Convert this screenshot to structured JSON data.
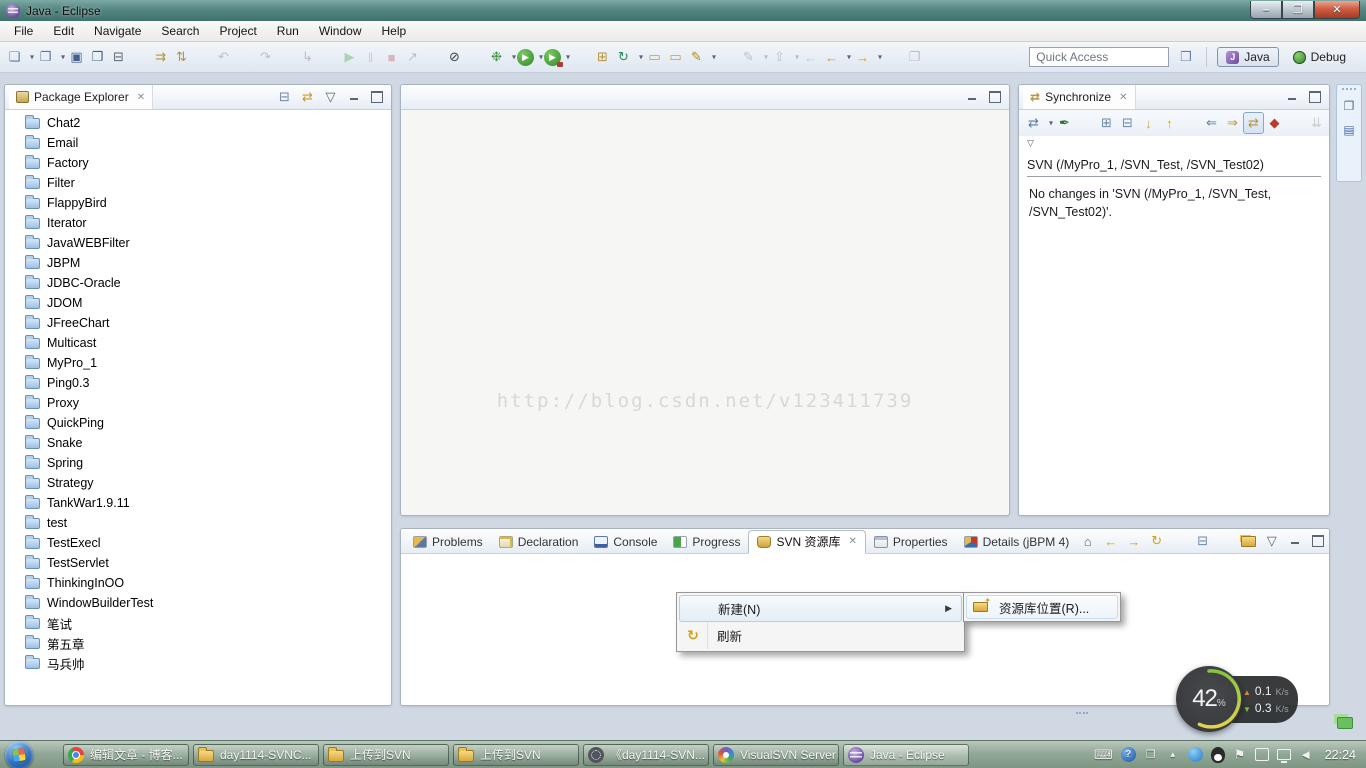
{
  "glyphs": {
    "close": "✕",
    "submenu_arrow": "▶"
  },
  "window": {
    "title": "Java - Eclipse",
    "controls": [
      {
        "icon": "minimize-button",
        "glyph": "–"
      },
      {
        "icon": "restore-button",
        "glyph": "❐"
      },
      {
        "icon": "close-button",
        "glyph": "✕"
      }
    ]
  },
  "menu_bar": {
    "items": [
      "File",
      "Edit",
      "Navigate",
      "Search",
      "Project",
      "Run",
      "Window",
      "Help"
    ]
  },
  "toolbar": {
    "icons": [
      {
        "icon": "new-wizard-icon",
        "glyph": "❏",
        "color": "#5b79a5",
        "dropdown": true
      },
      {
        "icon": "new-project-icon",
        "glyph": "❐",
        "color": "#5b79a5",
        "dropdown": true
      },
      {
        "icon": "save-icon",
        "glyph": "▣",
        "color": "#44618e"
      },
      {
        "icon": "save-all-icon",
        "glyph": "❒",
        "color": "#44618e"
      },
      {
        "icon": "print-icon",
        "glyph": "⊟",
        "color": "#5d6570"
      },
      {
        "icon": "divider"
      },
      {
        "icon": "svn-update-icon",
        "glyph": "⇉",
        "color": "#b8943c"
      },
      {
        "icon": "svn-commit-icon",
        "glyph": "⇅",
        "color": "#b8943c"
      },
      {
        "icon": "divider"
      },
      {
        "icon": "undo-icon",
        "glyph": "↶",
        "color": "#667",
        "disabled": true
      },
      {
        "icon": "divider"
      },
      {
        "icon": "redo-icon",
        "glyph": "↷",
        "color": "#667",
        "disabled": true
      },
      {
        "icon": "divider"
      },
      {
        "icon": "drop-to-frame-icon",
        "glyph": "↳",
        "color": "#667",
        "disabled": true
      },
      {
        "icon": "divider"
      },
      {
        "icon": "resume-icon",
        "glyph": "▶",
        "color": "#3da53d",
        "disabled": true
      },
      {
        "icon": "suspend-icon",
        "glyph": "‖",
        "color": "#c08080",
        "disabled": true
      },
      {
        "icon": "terminate-icon",
        "glyph": "■",
        "color": "#c05050",
        "disabled": true
      },
      {
        "icon": "disconnect-icon",
        "glyph": "↗",
        "color": "#667",
        "disabled": true
      },
      {
        "icon": "divider"
      },
      {
        "icon": "skip-breakpoints-icon",
        "glyph": "⊘",
        "color": "#3a4350"
      },
      {
        "icon": "divider"
      },
      {
        "icon": "debug-icon",
        "glyph": "❉",
        "color": "#3e8f3e",
        "dropdown": true
      },
      {
        "icon": "run-icon",
        "glyph": "▶",
        "dropdown": true
      },
      {
        "icon": "profile-icon",
        "glyph": "▶",
        "dropdown": true
      },
      {
        "icon": "divider"
      },
      {
        "icon": "new-java-project-icon",
        "glyph": "⊞",
        "color": "#b8943c"
      },
      {
        "icon": "refresh-repository-icon",
        "glyph": "↻",
        "color": "#2e8b57",
        "dropdown": true
      },
      {
        "icon": "open-type-icon",
        "glyph": "▭",
        "color": "#d4a017"
      },
      {
        "icon": "open-resource-icon",
        "glyph": "▭",
        "color": "#d4a017"
      },
      {
        "icon": "search-icon",
        "glyph": "✎",
        "color": "#b8860b",
        "dropdown": true
      },
      {
        "icon": "divider"
      },
      {
        "icon": "last-edit-location-icon",
        "glyph": "✎",
        "color": "#667",
        "disabled": true,
        "dropdown": true
      },
      {
        "icon": "previous-annotation-icon",
        "glyph": "⇧",
        "color": "#667",
        "disabled": true,
        "dropdown": true
      },
      {
        "icon": "back-disabled-icon",
        "glyph": "←",
        "color": "#889",
        "disabled": true
      },
      {
        "icon": "back-icon",
        "glyph": "←",
        "color": "#d4a017",
        "dropdown": true
      },
      {
        "icon": "forward-icon",
        "glyph": "→",
        "color": "#d4a017",
        "dropdown": true
      },
      {
        "icon": "divider"
      },
      {
        "icon": "pin-editor-icon",
        "glyph": "❐",
        "color": "#667",
        "disabled": true
      }
    ],
    "quick_access": {
      "placeholder": "Quick Access"
    },
    "open_perspective": {
      "glyph": "❒"
    },
    "perspectives": [
      {
        "label": "Java",
        "icon": "java-perspective-icon",
        "active": true
      },
      {
        "label": "Debug",
        "icon": "debug-perspective-icon"
      }
    ]
  },
  "package_explorer": {
    "title": "Package Explorer",
    "toolbar": [
      {
        "icon": "collapse-all-icon",
        "glyph": "⊟",
        "color": "#6b87a8"
      },
      {
        "icon": "link-with-editor-icon",
        "glyph": "⇄",
        "color": "#c89a2e"
      },
      {
        "icon": "view-menu-icon",
        "glyph": "▽",
        "color": "#5b6573"
      },
      {
        "icon": "minimize-icon"
      },
      {
        "icon": "maximize-icon"
      }
    ],
    "projects": [
      "Chat2",
      "Email",
      "Factory",
      "Filter",
      "FlappyBird",
      "Iterator",
      "JavaWEBFilter",
      "JBPM",
      "JDBC-Oracle",
      "JDOM",
      "JFreeChart",
      "Multicast",
      "MyPro_1",
      "Ping0.3",
      "Proxy",
      "QuickPing",
      "Snake",
      "Spring",
      "Strategy",
      "TankWar1.9.11",
      "test",
      "TestExecl",
      "TestServlet",
      "ThinkingInOO",
      "WindowBuilderTest",
      "笔试",
      "第五章",
      "马兵帅"
    ]
  },
  "editor": {
    "watermark": "http://blog.csdn.net/v123411739",
    "controls": [
      {
        "icon": "minimize-icon"
      },
      {
        "icon": "maximize-icon"
      }
    ]
  },
  "synchronize": {
    "title": "Synchronize",
    "header_controls": [
      {
        "icon": "minimize-icon"
      },
      {
        "icon": "maximize-icon"
      }
    ],
    "toolbar": [
      {
        "icon": "synchronize-icon",
        "glyph": "⇄",
        "color": "#5b79a5",
        "dropdown": true
      },
      {
        "icon": "pin-icon",
        "glyph": "✒",
        "color": "#2f6f2f"
      },
      {
        "icon": "divider"
      },
      {
        "icon": "expand-all-icon",
        "glyph": "⊞",
        "color": "#6b87a8"
      },
      {
        "icon": "collapse-all-icon",
        "glyph": "⊟",
        "color": "#6b87a8"
      },
      {
        "icon": "incoming-change-icon",
        "glyph": "↓",
        "color": "#dca637"
      },
      {
        "icon": "outgoing-change-icon",
        "glyph": "↑",
        "color": "#dca637"
      },
      {
        "icon": "divider"
      },
      {
        "icon": "incoming-mode-icon",
        "glyph": "⇐",
        "color": "#5b79a5"
      },
      {
        "icon": "outgoing-mode-icon",
        "glyph": "⇒",
        "color": "#b8943c"
      },
      {
        "icon": "both-mode-icon",
        "glyph": "⇄",
        "color": "#b8943c",
        "selected": true
      },
      {
        "icon": "conflicts-mode-icon",
        "glyph": "◆",
        "color": "#c0392b"
      },
      {
        "icon": "divider"
      },
      {
        "icon": "update-all-icon",
        "glyph": "⇊",
        "color": "#888",
        "disabled": true
      }
    ],
    "overflow_glyph": "▽",
    "section_header": "SVN (/MyPro_1, /SVN_Test, /SVN_Test02)",
    "message": "No changes in 'SVN (/MyPro_1, /SVN_Test, /SVN_Test02)'."
  },
  "minimized_strip": {
    "icons": [
      {
        "icon": "restore-view-icon",
        "glyph": "❐",
        "color": "#5b6b7d"
      },
      {
        "icon": "outline-view-icon",
        "glyph": "▤",
        "color": "#4a6ea9"
      }
    ]
  },
  "bottom_panel": {
    "tabs": [
      {
        "label": "Problems",
        "icon": "problems-icon"
      },
      {
        "label": "Declaration",
        "icon": "declaration-icon"
      },
      {
        "label": "Console",
        "icon": "console-icon"
      },
      {
        "label": "Progress",
        "icon": "progress-icon"
      },
      {
        "label": "SVN 资源库",
        "icon": "svn-repository-tab-icon",
        "active": true,
        "closable": true
      },
      {
        "label": "Properties",
        "icon": "properties-icon"
      },
      {
        "label": "Details (jBPM 4)",
        "icon": "details-icon"
      }
    ],
    "toolbar": [
      {
        "icon": "home-icon",
        "glyph": "⌂",
        "color": "#5b6573"
      },
      {
        "icon": "back-icon",
        "glyph": "←",
        "color": "#d4a017"
      },
      {
        "icon": "forward-icon",
        "glyph": "→",
        "color": "#d4a017"
      },
      {
        "icon": "refresh-icon",
        "glyph": "↻",
        "color": "#d4a017"
      },
      {
        "icon": "divider"
      },
      {
        "icon": "collapse-all-icon",
        "glyph": "⊟",
        "color": "#6b87a8"
      },
      {
        "icon": "divider"
      },
      {
        "icon": "new-repository-icon"
      },
      {
        "icon": "view-menu-icon",
        "glyph": "▽",
        "color": "#5b6573"
      },
      {
        "icon": "minimize-icon"
      },
      {
        "icon": "maximize-icon"
      }
    ]
  },
  "context_menu": {
    "items": [
      {
        "label": "新建(N)",
        "icon": "blank",
        "highlighted": true,
        "has_submenu": true
      },
      {
        "label": "刷新",
        "icon": "refresh-menu-icon",
        "glyph": "↻"
      }
    ],
    "submenu": [
      {
        "label": "资源库位置(R)...",
        "icon": "svn-repository-location-icon"
      }
    ]
  },
  "network_widget": {
    "percent_value": "42",
    "percent_unit": "%",
    "upload_arrow": "▲",
    "upload_value": "0.1",
    "upload_unit": "K/s",
    "download_arrow": "▼",
    "download_value": "0.3",
    "download_unit": "K/s"
  },
  "taskbar": {
    "buttons": [
      {
        "label": "编辑文章 - 博客...",
        "icon": "chrome-icon"
      },
      {
        "label": "day1114-SVNC...",
        "icon": "folder-icon"
      },
      {
        "label": "上传到SVN",
        "icon": "folder-icon"
      },
      {
        "label": "上传到SVN",
        "icon": "folder-icon"
      },
      {
        "label": "《day1114-SVN...",
        "icon": "media-player-icon"
      },
      {
        "label": "VisualSVN Server",
        "icon": "visualsvn-icon"
      },
      {
        "label": "Java - Eclipse",
        "icon": "eclipse-icon",
        "active": true
      }
    ],
    "tray": [
      {
        "icon": "keyboard-icon",
        "glyph": "⌨"
      },
      {
        "icon": "help-icon",
        "glyph": "?"
      },
      {
        "icon": "popup-window-icon",
        "glyph": "❐"
      },
      {
        "icon": "show-hidden-icons",
        "glyph": "▴"
      },
      {
        "icon": "wangwang-icon"
      },
      {
        "icon": "qq-icon"
      },
      {
        "icon": "action-center-icon",
        "glyph": "⚑"
      },
      {
        "icon": "power-icon"
      },
      {
        "icon": "network-icon"
      },
      {
        "icon": "volume-icon",
        "glyph": "◄"
      }
    ],
    "clock": "22:24"
  }
}
